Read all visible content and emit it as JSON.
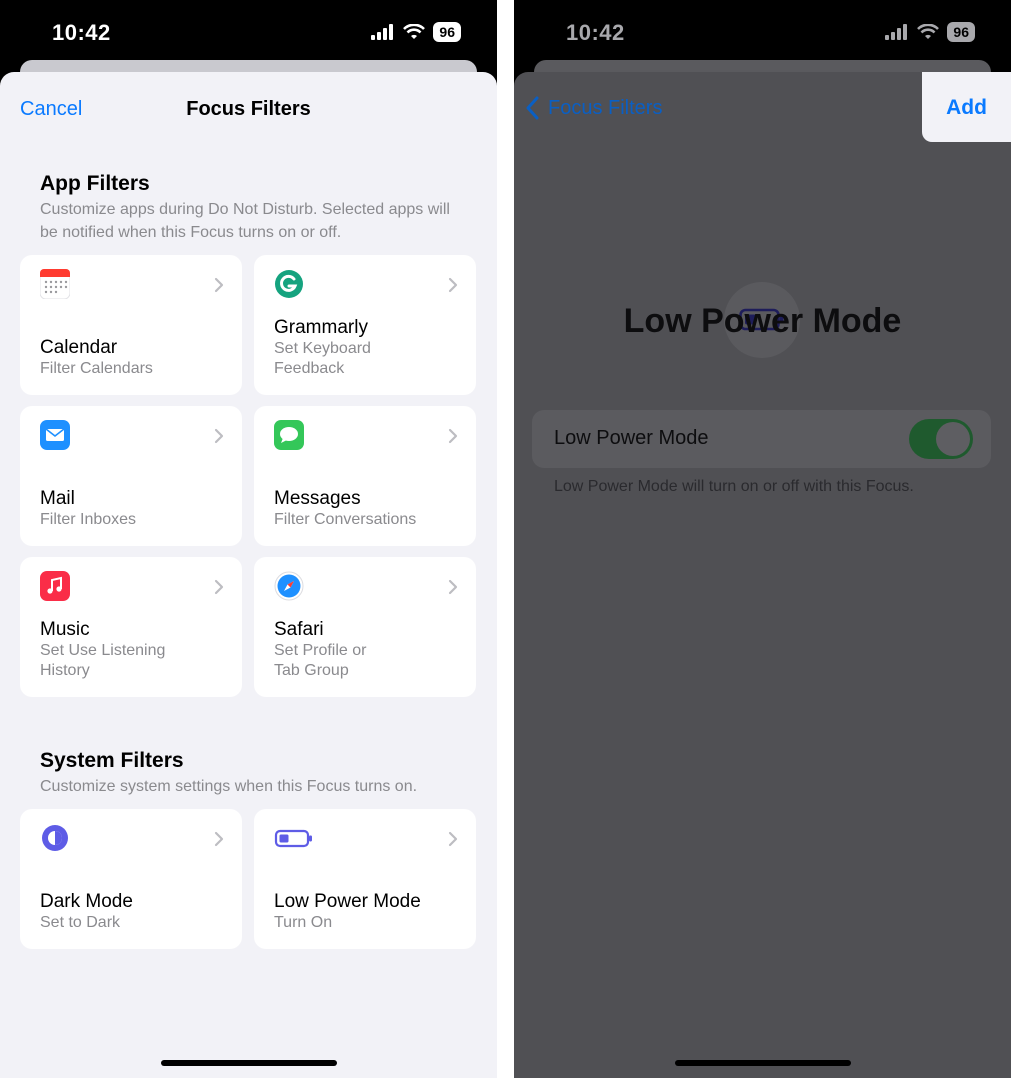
{
  "left": {
    "status": {
      "time": "10:42",
      "battery": "96"
    },
    "nav": {
      "cancel": "Cancel",
      "title": "Focus Filters"
    },
    "app_filters": {
      "header": "App Filters",
      "desc": "Customize apps during Do Not Disturb. Selected apps will be notified when this Focus turns on or off.",
      "tiles": [
        {
          "title": "Calendar",
          "sub": "Filter Calendars",
          "icon": "calendar-icon"
        },
        {
          "title": "Grammarly",
          "sub": "Set Keyboard Feedback",
          "icon": "grammarly-icon"
        },
        {
          "title": "Mail",
          "sub": "Filter Inboxes",
          "icon": "mail-icon"
        },
        {
          "title": "Messages",
          "sub": "Filter Conversations",
          "icon": "messages-icon"
        },
        {
          "title": "Music",
          "sub": "Set Use Listening History",
          "icon": "music-icon"
        },
        {
          "title": "Safari",
          "sub": "Set Profile or Tab Group",
          "icon": "safari-icon"
        }
      ]
    },
    "system_filters": {
      "header": "System Filters",
      "desc": "Customize system settings when this Focus turns on.",
      "tiles": [
        {
          "title": "Dark Mode",
          "sub": "Set to Dark",
          "icon": "dark-mode-icon"
        },
        {
          "title": "Low Power Mode",
          "sub": "Turn On",
          "icon": "battery-icon"
        }
      ]
    }
  },
  "right": {
    "status": {
      "time": "10:42",
      "battery": "96"
    },
    "nav": {
      "back": "Focus Filters",
      "add": "Add"
    },
    "title": "Low Power Mode",
    "toggle": {
      "label": "Low Power Mode",
      "on": true
    },
    "footer": "Low Power Mode will turn on or off with this Focus."
  },
  "colors": {
    "accent": "#0a7aff",
    "toggle_on": "#34c759"
  }
}
